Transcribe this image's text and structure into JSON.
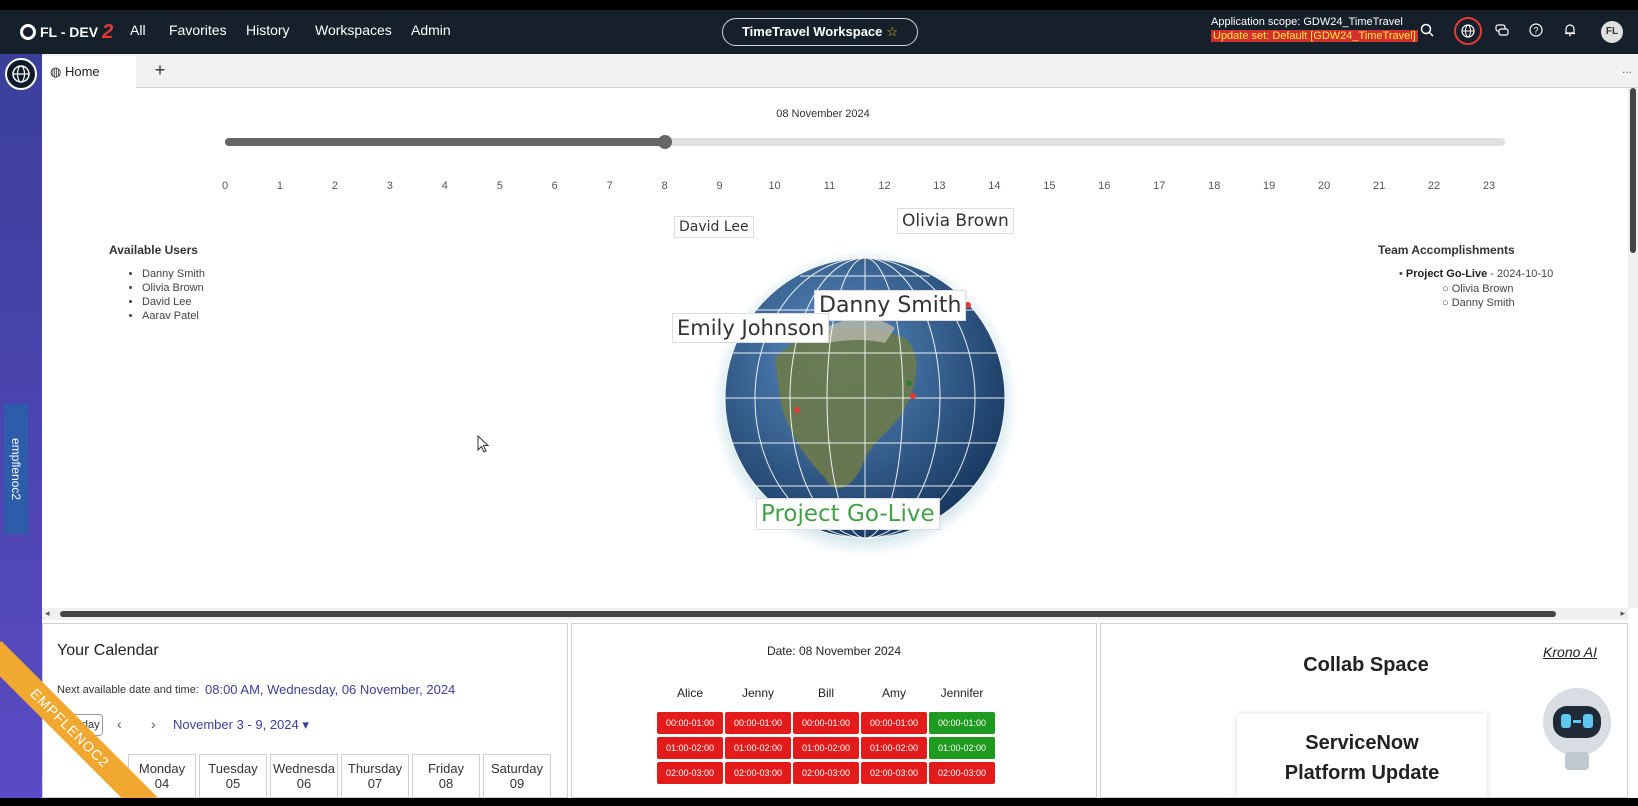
{
  "nav": {
    "logo_text": "FL - DEV",
    "logo_num": "2",
    "items": [
      "All",
      "Favorites",
      "History",
      "Workspaces",
      "Admin"
    ],
    "workspace": "TimeTravel Workspace",
    "scope": "Application scope: GDW24_TimeTravel",
    "update_set": "Update set: Default [GDW24_TimeTravel]",
    "avatar": "FL"
  },
  "rail": {
    "tag": "empflenoc2"
  },
  "tabs": {
    "home": "Home",
    "add": "+",
    "more": "..."
  },
  "timeline": {
    "date": "08 November 2024",
    "ticks": [
      "0",
      "1",
      "2",
      "3",
      "4",
      "5",
      "6",
      "7",
      "8",
      "9",
      "10",
      "11",
      "12",
      "13",
      "14",
      "15",
      "16",
      "17",
      "18",
      "19",
      "20",
      "21",
      "22",
      "23"
    ],
    "hour_value": 8,
    "max_hour": 23
  },
  "available_users": {
    "title": "Available Users",
    "users": [
      "Danny Smith",
      "Olivia Brown",
      "David Lee",
      "Aarav Patel"
    ]
  },
  "team_accomplishments": {
    "title": "Team Accomplishments",
    "project": "Project Go-Live",
    "date": " - 2024-10-10",
    "members": [
      "Olivia Brown",
      "Danny Smith"
    ]
  },
  "globe": {
    "labels": {
      "david": "David Lee",
      "olivia": "Olivia Brown",
      "danny": "Danny Smith",
      "emily": "Emily Johnson",
      "project": "Project Go-Live"
    }
  },
  "calendar": {
    "title": "Your Calendar",
    "next_label": "Next available date and time:",
    "next_value": "08:00 AM, Wednesday, 06 November, 2024",
    "today": "Today",
    "range": "November 3 - 9, 2024 ▾",
    "days": [
      {
        "name": "Monday",
        "num": "04"
      },
      {
        "name": "Tuesday",
        "num": "05"
      },
      {
        "name": "Wednesda",
        "num": "06"
      },
      {
        "name": "Thursday",
        "num": "07"
      },
      {
        "name": "Friday",
        "num": "08"
      },
      {
        "name": "Saturday",
        "num": "09"
      }
    ]
  },
  "schedule": {
    "date": "Date: 08 November 2024",
    "people": [
      "Alice",
      "Jenny",
      "Bill",
      "Amy",
      "Jennifer"
    ],
    "rows": [
      "00:00-01:00",
      "01:00-02:00",
      "02:00-03:00"
    ],
    "status": [
      [
        "busy",
        "busy",
        "busy",
        "busy",
        "free"
      ],
      [
        "busy",
        "busy",
        "busy",
        "busy",
        "free"
      ],
      [
        "busy",
        "busy",
        "busy",
        "busy",
        "busy"
      ]
    ],
    "colors": {
      "busy": "#e31b1b",
      "free": "#1e9a1e"
    }
  },
  "collab": {
    "title": "Collab Space",
    "krono": "Krono AI",
    "card_line1": "ServiceNow",
    "card_line2": "Platform Update"
  },
  "ribbon": "EMPFLENOC2"
}
